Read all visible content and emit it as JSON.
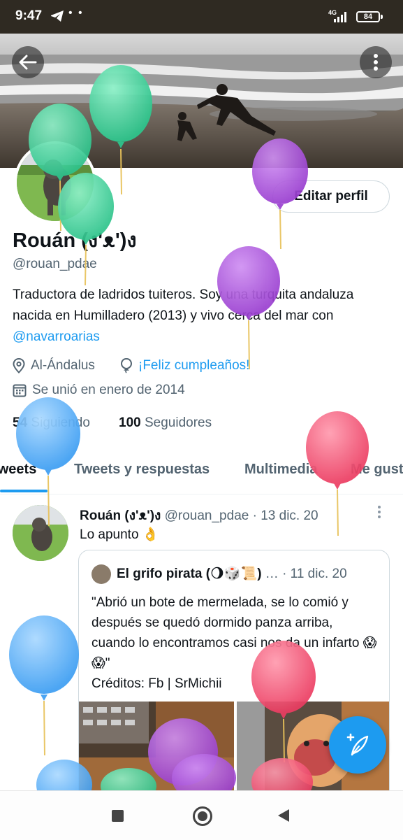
{
  "status_bar": {
    "time": "9:47",
    "network": "4G",
    "battery": "84",
    "dots": "• •"
  },
  "profile": {
    "edit_label": "Editar perfil",
    "display_name": "Rouán (ง'ᴥ')ง",
    "handle": "@rouan_pdae",
    "bio_text": "Traductora de ladridos tuiteros. Soy una turquita andaluza nacida en Humilladero (2013) y vivo cerca del mar con ",
    "bio_link": "@navarroarias",
    "location": "Al-Ándalus",
    "birthday": "¡Feliz cumpleaños!",
    "joined": "Se unió en enero de 2014",
    "following_count": "54",
    "following_label": "Siguiendo",
    "followers_count": "100",
    "followers_label": "Seguidores"
  },
  "tabs": [
    {
      "label": "Tweets"
    },
    {
      "label": "Tweets y respuestas"
    },
    {
      "label": "Multimedia"
    },
    {
      "label": "Me gusta"
    }
  ],
  "tweet": {
    "author": "Rouán (ง'ᴥ')ง",
    "meta": " @rouan_pdae · 13 dic. 20",
    "text": "Lo apunto 👌",
    "quote": {
      "author": "El grifo pirata (🌖🎲📜)",
      "meta": " … · 11 dic. 20",
      "text": "\"Abrió un bote de mermelada, se lo comió y  después se quedó dormido panza arriba, cuando lo encontramos casi nos da un infarto 😱😱\"",
      "credits": "Créditos: Fb | SrMichii"
    }
  },
  "icons": {
    "back": "back-arrow-icon",
    "more": "more-vertical-icon",
    "location": "location-pin-icon",
    "birthday": "balloon-icon",
    "calendar": "calendar-icon",
    "compose": "compose-feather-icon"
  },
  "colors": {
    "accent": "#1d9bf0",
    "balloon_green": "#3ecf9a",
    "balloon_purple": "#a04ed6",
    "balloon_blue": "#49a8f5",
    "balloon_red": "#f0466a"
  }
}
